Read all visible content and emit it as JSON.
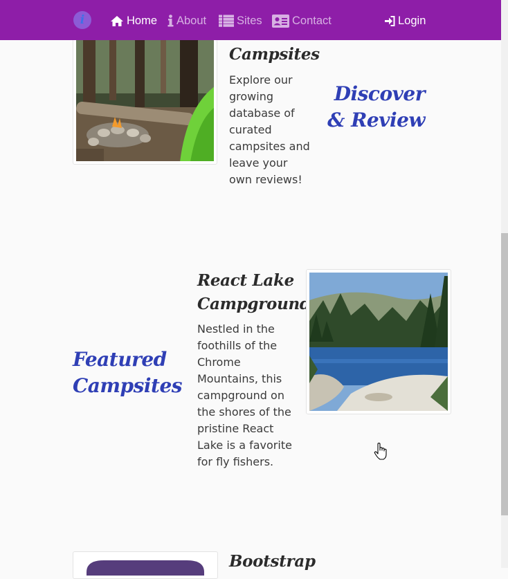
{
  "nav": {
    "brand_letter": "i",
    "home": "Home",
    "about": "About",
    "sites": "Sites",
    "contact": "Contact",
    "login": "Login",
    "background": "#8e1ea8"
  },
  "discover": {
    "title": "Campsites",
    "text": "Explore our growing database of curated campsites and leave your own reviews!",
    "heading": "Discover & Review"
  },
  "featured": {
    "title": "React Lake Campground",
    "text": "Nestled in the foothills of the Chrome Mountains, this campground on the shores of the pristine React Lake is a favorite for fly fishers.",
    "heading": "Featured Campsites"
  },
  "bootstrap": {
    "title": "Bootstrap"
  },
  "colors": {
    "heading_blue": "#2f3fb5",
    "navbar_purple": "#8e1ea8"
  }
}
